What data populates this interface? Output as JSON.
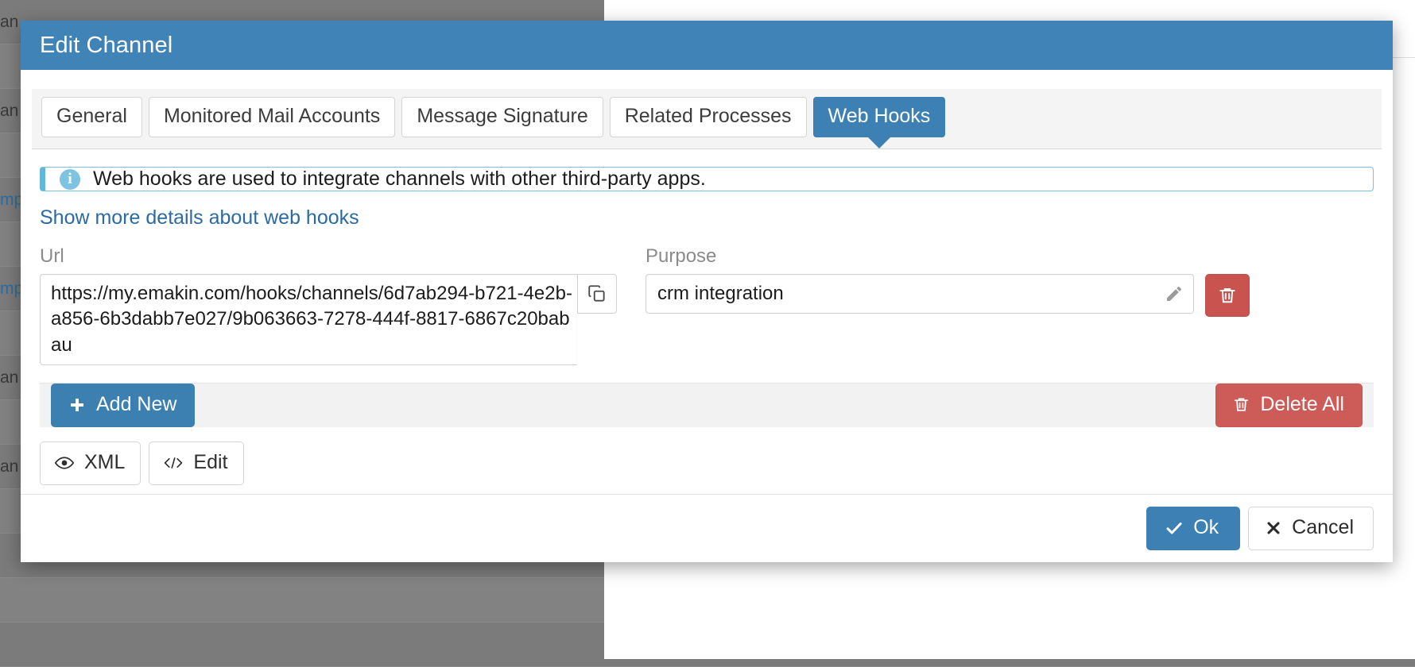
{
  "window": {
    "title": "Edit Channel"
  },
  "tabs": [
    {
      "label": "General",
      "active": false
    },
    {
      "label": "Monitored Mail Accounts",
      "active": false
    },
    {
      "label": "Message Signature",
      "active": false
    },
    {
      "label": "Related Processes",
      "active": false
    },
    {
      "label": "Web Hooks",
      "active": true
    }
  ],
  "info": {
    "icon": "info-icon",
    "text": "Web hooks are used to integrate channels with other third-party apps.",
    "accent": "#63b8da"
  },
  "more_details_link": "Show more details about web hooks",
  "fields": {
    "url_label": "Url",
    "purpose_label": "Purpose"
  },
  "hooks": [
    {
      "url": "https://my.emakin.com/hooks/channels/6d7ab294-b721-4e2b-a856-6b3dabb7e027/9b063663-7278-444f-8817-6867c20babau",
      "purpose": "crm integration",
      "copy_icon": "copy-icon",
      "edit_icon": "pencil-icon",
      "delete_icon": "trash-icon"
    }
  ],
  "toolbar": {
    "add_new_label": "Add New",
    "add_new_icon": "plus-icon",
    "delete_all_label": "Delete All",
    "delete_all_icon": "trash-icon",
    "primary_color": "#3c7fb1",
    "danger_color": "#cd5c58"
  },
  "source_buttons": {
    "xml_label": "XML",
    "xml_icon": "eye-icon",
    "edit_label": "Edit",
    "edit_icon": "code-icon"
  },
  "footer": {
    "ok_label": "Ok",
    "ok_icon": "check-icon",
    "cancel_label": "Cancel",
    "cancel_icon": "x-icon"
  },
  "background_rows": [
    {
      "text": "an",
      "link": false
    },
    {
      "text": "",
      "link": false
    },
    {
      "text": "an",
      "link": false
    },
    {
      "text": "",
      "link": false
    },
    {
      "text": "mp",
      "link": true
    },
    {
      "text": "",
      "link": false
    },
    {
      "text": "mp",
      "link": true
    },
    {
      "text": "",
      "link": false
    },
    {
      "text": "an",
      "link": false
    },
    {
      "text": "",
      "link": false
    },
    {
      "text": "an",
      "link": false
    },
    {
      "text": "",
      "link": false
    },
    {
      "text": "",
      "link": false
    },
    {
      "text": "",
      "link": false
    },
    {
      "text": "",
      "link": false
    }
  ]
}
